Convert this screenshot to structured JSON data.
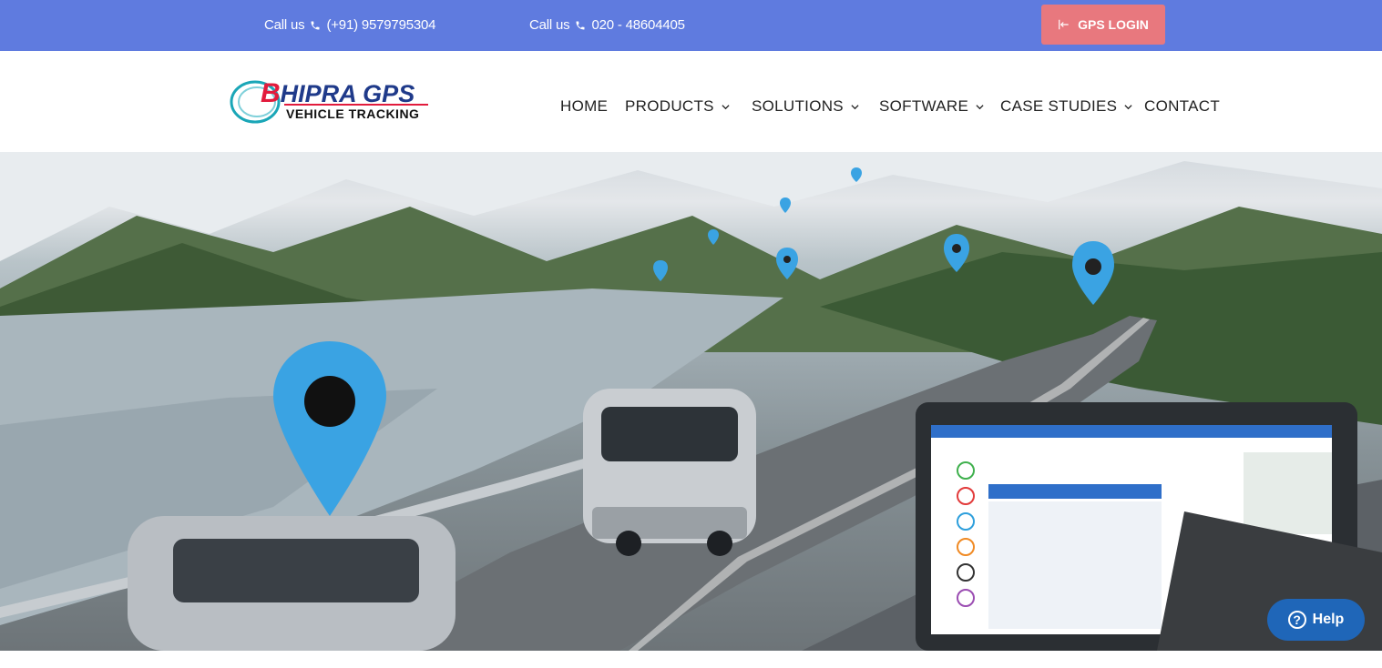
{
  "topbar": {
    "call1_label": "Call us",
    "call1_number": "(+91) 9579795304",
    "call2_label": "Call us",
    "call2_number": "020 - 48604405",
    "login_label": "GPS LOGIN"
  },
  "logo": {
    "brand_initial": "B",
    "brand_rest": "HIPRA GPS",
    "tagline": "VEHICLE TRACKING"
  },
  "nav": {
    "home": "HOME",
    "products": "PRODUCTS",
    "solutions": "SOLUTIONS",
    "software": "SOFTWARE",
    "case_studies": "CASE STUDIES",
    "contact": "CONTACT"
  },
  "help": {
    "label": "Help",
    "glyph": "?"
  },
  "colors": {
    "topbar": "#5f7bdf",
    "login_button": "#e8787e",
    "help_button": "#1f66b8",
    "pin": "#3aa3e3"
  },
  "icons": [
    "phone-icon",
    "sign-in-icon",
    "chevron-down-icon",
    "map-pin-icon",
    "help-icon"
  ]
}
